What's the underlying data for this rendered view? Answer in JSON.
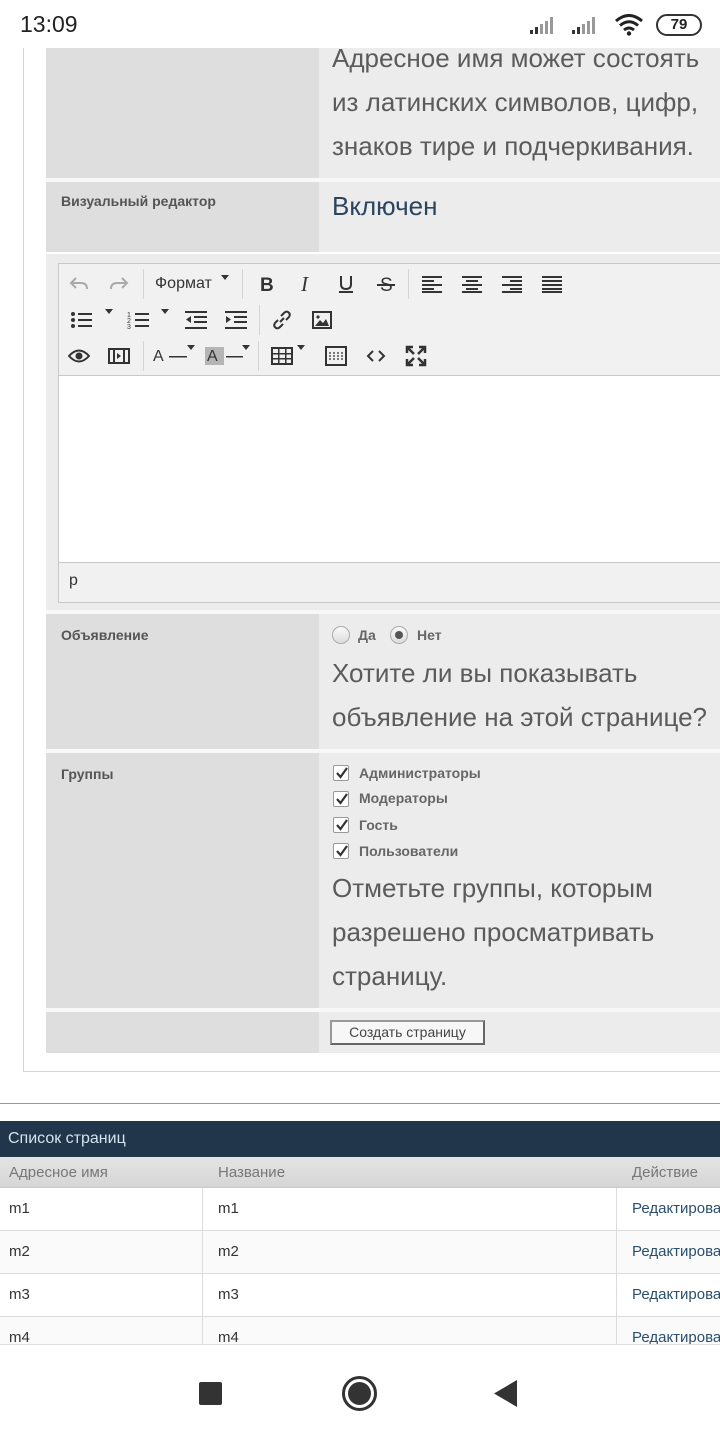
{
  "status_bar": {
    "time": "13:09",
    "battery": "79"
  },
  "form": {
    "alias_hint_lines": [
      "Адресное имя может состоять",
      "из латинских символов, цифр,",
      "знаков тире и подчеркивания."
    ],
    "visual_editor": {
      "label": "Визуальный редактор",
      "value": "Включен"
    },
    "editor": {
      "format_label": "Формат",
      "status_path": "p",
      "tool_icons": [
        "undo-icon",
        "redo-icon",
        "bold-icon",
        "italic-icon",
        "underline-icon",
        "strikethrough-icon",
        "align-left-icon",
        "align-center-icon",
        "align-right-icon",
        "align-justify-icon",
        "bullet-list-icon",
        "numbered-list-icon",
        "outdent-icon",
        "indent-icon",
        "link-icon",
        "image-icon",
        "preview-icon",
        "media-icon",
        "text-color-icon",
        "background-color-icon",
        "table-icon",
        "visual-aid-icon",
        "source-code-icon",
        "fullscreen-icon"
      ]
    },
    "announcement": {
      "label": "Объявление",
      "option_yes": "Да",
      "option_no": "Нет",
      "selected": "Нет",
      "hint_lines": [
        "Хотите ли вы показывать",
        "объявление на этой странице?"
      ]
    },
    "groups": {
      "label": "Группы",
      "items": [
        {
          "label": "Администраторы",
          "checked": true
        },
        {
          "label": "Модераторы",
          "checked": true
        },
        {
          "label": "Гость",
          "checked": true
        },
        {
          "label": "Пользователи",
          "checked": true
        }
      ],
      "hint_lines": [
        "Отметьте группы, которым",
        "разрешено просматривать",
        "страницу."
      ]
    },
    "submit_label": "Создать страницу"
  },
  "page_list": {
    "title": "Список страниц",
    "columns": [
      "Адресное имя",
      "Название",
      "Действие"
    ],
    "rows": [
      {
        "alias": "m1",
        "name": "m1",
        "action": "Редактировать"
      },
      {
        "alias": "m2",
        "name": "m2",
        "action": "Редактировать"
      },
      {
        "alias": "m3",
        "name": "m3",
        "action": "Редактировать"
      },
      {
        "alias": "m4",
        "name": "m4",
        "action": "Редактировать"
      }
    ]
  },
  "nav_icons": [
    "recents-square-icon",
    "home-circle-icon",
    "back-triangle-icon"
  ],
  "colors": {
    "header_bg": "#21364a",
    "label_cell": "#dedede",
    "value_cell": "#ececec",
    "link": "#2b4f6e"
  }
}
